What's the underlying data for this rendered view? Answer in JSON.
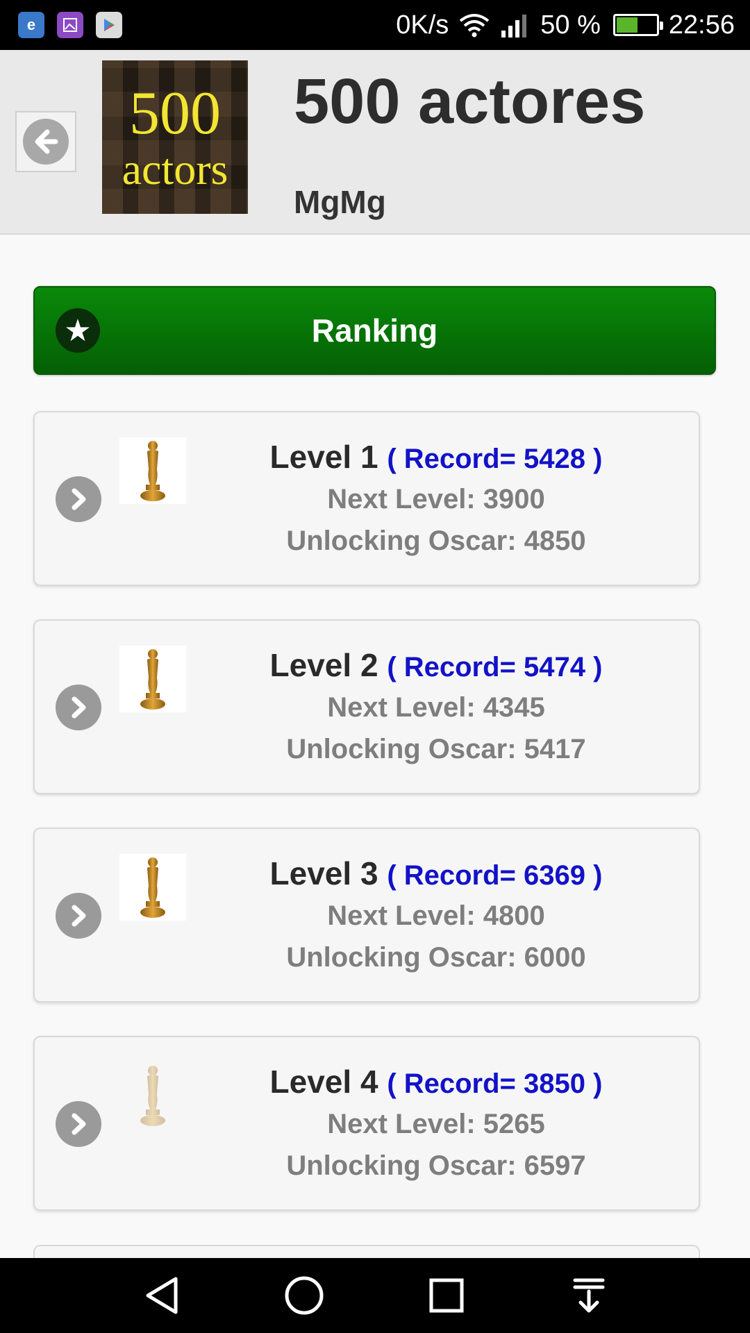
{
  "status_bar": {
    "net_speed": "0K/s",
    "battery_percent": "50 %",
    "battery_level": 0.5,
    "time": "22:56",
    "notification_icons": [
      "browser-icon",
      "gallery-icon",
      "play-store-icon"
    ]
  },
  "header": {
    "logo_line1": "500",
    "logo_line2": "actors",
    "title": "500 actores",
    "user": "MgMg"
  },
  "ranking": {
    "label": "Ranking"
  },
  "levels": [
    {
      "name": "Level 1",
      "record": "( Record= 5428 )",
      "next": "Next Level: 3900",
      "unlock": "Unlocking Oscar: 4850",
      "unlocked": true
    },
    {
      "name": "Level 2",
      "record": "( Record= 5474 )",
      "next": "Next Level: 4345",
      "unlock": "Unlocking Oscar: 5417",
      "unlocked": true
    },
    {
      "name": "Level 3",
      "record": "( Record= 6369 )",
      "next": "Next Level: 4800",
      "unlock": "Unlocking Oscar: 6000",
      "unlocked": true
    },
    {
      "name": "Level 4",
      "record": "( Record= 3850 )",
      "next": "Next Level: 5265",
      "unlock": "Unlocking Oscar: 6597",
      "unlocked": false
    }
  ],
  "colors": {
    "ranking_green": "#067506",
    "record_blue": "#1212c8",
    "subtext_gray": "#7e7e7e"
  }
}
